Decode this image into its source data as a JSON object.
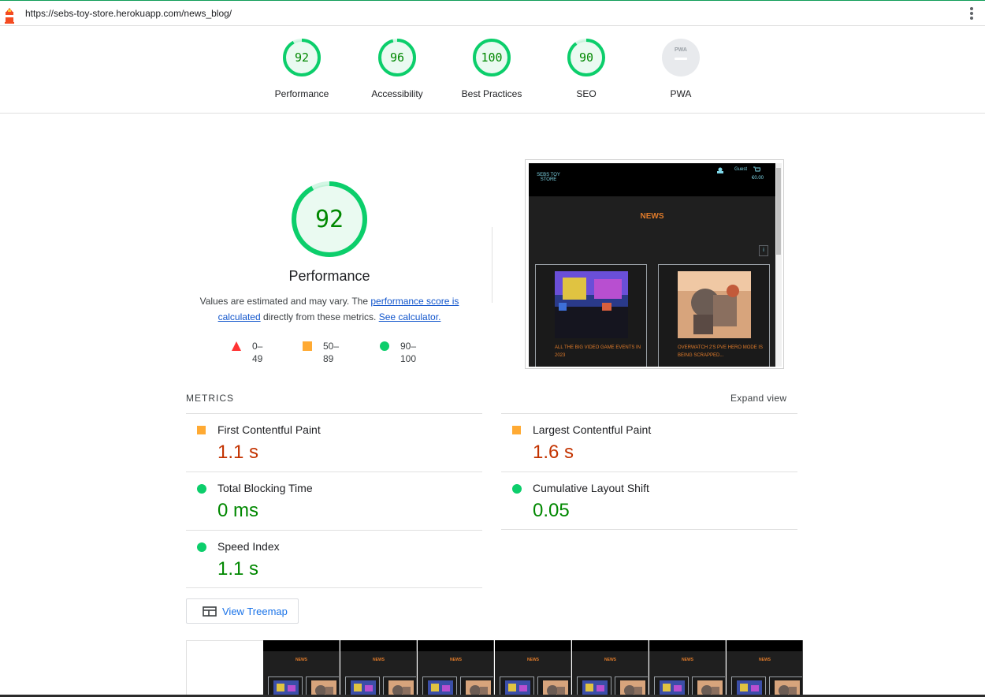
{
  "browser": {
    "url": "https://sebs-toy-store.herokuapp.com/news_blog/"
  },
  "gauges": [
    {
      "score": "92",
      "label": "Performance",
      "color": "#0cce6b",
      "fraction": 0.92
    },
    {
      "score": "96",
      "label": "Accessibility",
      "color": "#0cce6b",
      "fraction": 0.96
    },
    {
      "score": "100",
      "label": "Best Practices",
      "color": "#0cce6b",
      "fraction": 1.0
    },
    {
      "score": "90",
      "label": "SEO",
      "color": "#0cce6b",
      "fraction": 0.9
    },
    {
      "score": "PWA",
      "label": "PWA",
      "color": "#9aa0a6",
      "fraction": 0
    }
  ],
  "performance": {
    "score": "92",
    "title": "Performance",
    "desc_prefix": "Values are estimated and may vary. The ",
    "desc_link": "performance score is calculated",
    "desc_middle": " directly from these metrics. ",
    "desc_link2": "See calculator.",
    "legend": [
      {
        "range": "0–49",
        "shape": "triangle",
        "color": "#ff3333"
      },
      {
        "range": "50–89",
        "shape": "square",
        "color": "#ffaa33"
      },
      {
        "range": "90–100",
        "shape": "circle",
        "color": "#0cce6b"
      }
    ]
  },
  "screenshot": {
    "logo": "SEBS TOY STORE",
    "guest": "Guest",
    "price": "€0.00",
    "heading": "NEWS",
    "cards": [
      {
        "caption": "ALL THE BIG VIDEO GAME EVENTS IN 2023"
      },
      {
        "caption": "OVERWATCH 2'S PVE HERO MODE IS BEING SCRAPPED..."
      }
    ]
  },
  "metrics": {
    "heading": "METRICS",
    "expand_label": "Expand view",
    "items": [
      {
        "name": "First Contentful Paint",
        "value": "1.1 s",
        "status": "average",
        "color": "#c33300"
      },
      {
        "name": "Largest Contentful Paint",
        "value": "1.6 s",
        "status": "average",
        "color": "#c33300"
      },
      {
        "name": "Total Blocking Time",
        "value": "0 ms",
        "status": "pass",
        "color": "#008800"
      },
      {
        "name": "Cumulative Layout Shift",
        "value": "0.05",
        "status": "pass",
        "color": "#008800"
      },
      {
        "name": "Speed Index",
        "value": "1.1 s",
        "status": "pass",
        "color": "#008800"
      }
    ]
  },
  "treemap": {
    "label": "View Treemap"
  },
  "filmstrip": {
    "frame_heading": "NEWS"
  }
}
